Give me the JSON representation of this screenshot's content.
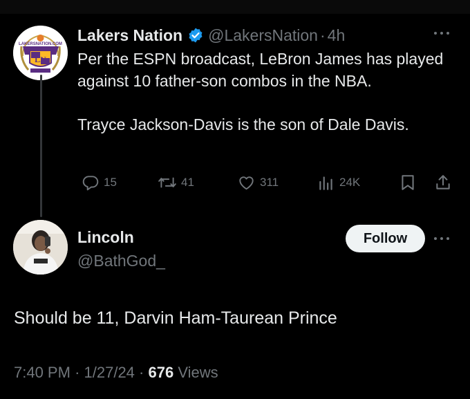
{
  "original_tweet": {
    "author_name": "Lakers Nation",
    "handle": "@LakersNation",
    "separator": "·",
    "time": "4h",
    "text_line1": "Per the ESPN broadcast, LeBron James has played against 10 father-son combos in the NBA.",
    "text_line2": "Trayce Jackson-Davis is the son of Dale Davis.",
    "avatar_logo_text": "LAKERSNATION.COM",
    "actions": {
      "replies": "15",
      "retweets": "41",
      "likes": "311",
      "views": "24K"
    },
    "icons": [
      "verified-badge-icon",
      "more-icon",
      "reply-icon",
      "retweet-icon",
      "like-icon",
      "views-icon",
      "bookmark-icon",
      "share-icon"
    ],
    "colors": {
      "verified": "#1d9bf0",
      "avatar_purple": "#5a2d82",
      "avatar_gold": "#fdb927"
    }
  },
  "reply_tweet": {
    "author_name": "Lincoln",
    "handle": "@BathGod_",
    "follow_label": "Follow",
    "text": "Should be 11, Darvin Ham-Taurean Prince",
    "time": "7:40 PM",
    "date": "1/27/24",
    "separator": "·",
    "views_count": "676",
    "views_label": "Views"
  },
  "theme": {
    "background": "#000000",
    "text": "#e7e9ea",
    "secondary": "#71767b",
    "follow_bg": "#eff3f4"
  }
}
